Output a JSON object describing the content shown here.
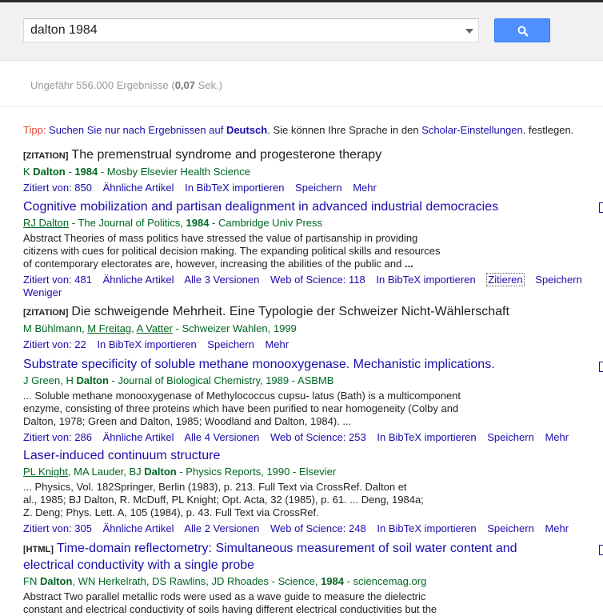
{
  "search": {
    "query": "dalton 1984"
  },
  "stats": {
    "prefix": "Ungefähr 556.000 Ergebnisse (",
    "time": "0,07",
    "suffix": " Sek.)"
  },
  "tip": {
    "label": "Tipp:",
    "text1": "Suchen Sie nur nach Ergebnissen auf",
    "lang": "Deutsch",
    "text2": ". Sie können Ihre Sprache in den",
    "settings_link": "Scholar-Einstellungen",
    "text3": ". festlegen."
  },
  "results": [
    {
      "tag": "[ZITATION]",
      "title": "The premenstrual syndrome and progesterone therapy",
      "meta": {
        "a": "K ",
        "b": "Dalton",
        "c": " - ",
        "d": "1984",
        "e": " - Mosby Elsevier Health Science"
      },
      "links": [
        "Zitiert von: 850",
        "Ähnliche Artikel",
        "In BibTeX importieren",
        "Speichern",
        "Mehr"
      ]
    },
    {
      "title": "Cognitive mobilization and partisan dealignment in advanced industrial democracies",
      "meta": {
        "a": "RJ Dalton",
        "c": " - The Journal of Politics, ",
        "d": "1984",
        "e": " - Cambridge Univ Press"
      },
      "snippet": [
        "Abstract Theories of mass politics have stressed the value of partisanship in providing",
        "citizens with cues for political decision making. The expanding political skills and resources",
        "of contemporary electorates are, however, increasing the abilities of the public and"
      ],
      "ellipsis": "...",
      "links": [
        "Zitiert von: 481",
        "Ähnliche Artikel",
        "Alle 3 Versionen",
        "Web of Science: 118",
        "In BibTeX importieren",
        "Zitieren",
        "Speichern"
      ],
      "links2": "Weniger"
    },
    {
      "tag": "[ZITATION]",
      "title": "Die schweigende Mehrheit. Eine Typologie der Schweizer Nicht-Wählerschaft",
      "meta": {
        "a": "M Bühlmann, ",
        "b": "M Freitag",
        "c": ", ",
        "d": "A Vatter",
        "e": " - Schweizer Wahlen, 1999"
      },
      "links": [
        "Zitiert von: 22",
        "In BibTeX importieren",
        "Speichern",
        "Mehr"
      ]
    },
    {
      "title": "Substrate specificity of soluble methane monooxygenase. Mechanistic implications.",
      "meta": {
        "a": "J Green, H ",
        "b": "Dalton",
        "e": " - Journal of Biological Chemistry, 1989 - ASBMB"
      },
      "snippet": [
        "... Soluble methane monooxygenase of Methylococcus cupsu- latus (Bath) is a multicomponent",
        "enzyme, consisting of three proteins which have been purified to near homogeneity (Colby and",
        "Dalton, 1978; Green and Dalton, 1985; Woodland and Dalton, 1984). ..."
      ],
      "links": [
        "Zitiert von: 286",
        "Ähnliche Artikel",
        "Alle 4 Versionen",
        "Web of Science: 253",
        "In BibTeX importieren",
        "Speichern",
        "Mehr"
      ]
    },
    {
      "title": "Laser-induced continuum structure",
      "meta": {
        "a": "PL Knight",
        "c": ", MA Lauder, BJ ",
        "b": "Dalton",
        "e": " - Physics Reports, 1990 - Elsevier"
      },
      "snippet": [
        "... Physics, Vol. 182Springer, Berlin (1983), p. 213. Full Text via CrossRef. Dalton et",
        "al., 1985; BJ Dalton, R. McDuff, PL Knight; Opt. Acta, 32 (1985), p. 61. ... Deng, 1984a;",
        "Z. Deng; Phys. Lett. A, 105 (1984), p. 43. Full Text via CrossRef."
      ],
      "links": [
        "Zitiert von: 305",
        "Ähnliche Artikel",
        "Alle 2 Versionen",
        "Web of Science: 248",
        "In BibTeX importieren",
        "Speichern",
        "Mehr"
      ]
    },
    {
      "tag": "[HTML]",
      "title": "Time-domain reflectometry: Simultaneous measurement of soil water content and",
      "title2": "electrical conductivity with a single probe",
      "meta": {
        "a": "FN ",
        "b": "Dalton",
        "c": ", WN Herkelrath, DS Rawlins, JD Rhoades - Science, ",
        "d": "1984",
        "e": " - sciencemag.org"
      },
      "snippet": [
        "Abstract Two parallel metallic rods were used as a wave guide to measure the dielectric",
        "constant and electrical conductivity of soils having different electrical conductivities but the"
      ]
    }
  ]
}
